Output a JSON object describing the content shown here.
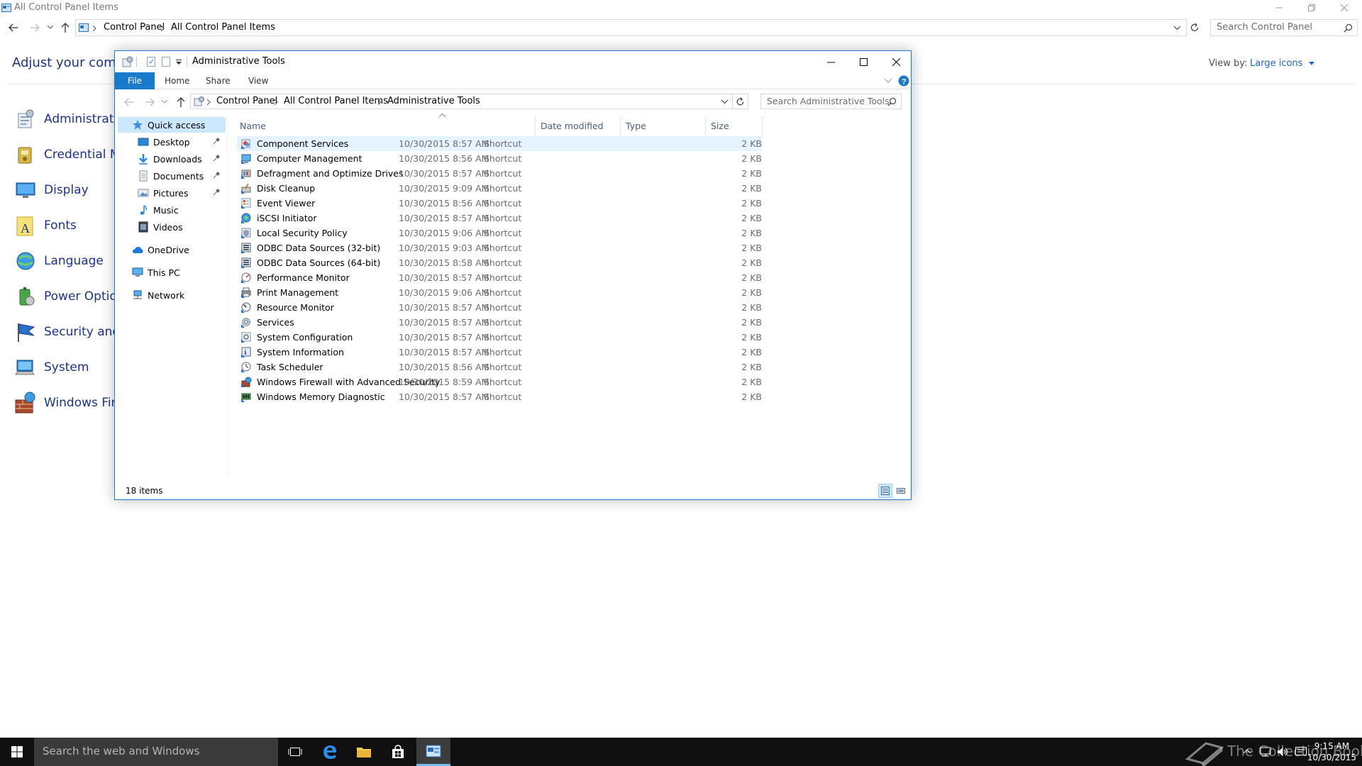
{
  "background_window": {
    "title": "All Control Panel Items",
    "breadcrumb": [
      "Control Panel",
      "All Control Panel Items"
    ],
    "search_placeholder": "Search Control Panel",
    "header": "Adjust your compute",
    "view_by_label": "View by:",
    "view_by_value": "Large icons",
    "items": [
      {
        "label": "Administrative",
        "icon": "administrative-tools-icon"
      },
      {
        "label": "Credential Ma",
        "icon": "credential-manager-icon"
      },
      {
        "label": "Display",
        "icon": "display-icon"
      },
      {
        "label": "Fonts",
        "icon": "fonts-icon"
      },
      {
        "label": "Language",
        "icon": "language-icon"
      },
      {
        "label": "Power Options",
        "icon": "power-options-icon"
      },
      {
        "label": "Security and M",
        "icon": "security-maintenance-icon"
      },
      {
        "label": "System",
        "icon": "system-icon"
      },
      {
        "label": "Windows Firew",
        "icon": "windows-firewall-icon"
      }
    ]
  },
  "explorer": {
    "title": "Administrative Tools",
    "ribbon": {
      "file": "File",
      "tabs": [
        "Home",
        "Share",
        "View"
      ]
    },
    "breadcrumb": [
      "Control Panel",
      "All Control Panel Items",
      "Administrative Tools"
    ],
    "search_placeholder": "Search Administrative Tools",
    "nav": {
      "quick_access": "Quick access",
      "pinned": [
        {
          "label": "Desktop",
          "pinned": true
        },
        {
          "label": "Downloads",
          "pinned": true
        },
        {
          "label": "Documents",
          "pinned": true
        },
        {
          "label": "Pictures",
          "pinned": true
        },
        {
          "label": "Music",
          "pinned": false
        },
        {
          "label": "Videos",
          "pinned": false
        }
      ],
      "onedrive": "OneDrive",
      "this_pc": "This PC",
      "network": "Network"
    },
    "columns": {
      "name": "Name",
      "date": "Date modified",
      "type": "Type",
      "size": "Size"
    },
    "files": [
      {
        "name": "Component Services",
        "date": "10/30/2015 8:57 AM",
        "type": "Shortcut",
        "size": "2 KB"
      },
      {
        "name": "Computer Management",
        "date": "10/30/2015 8:56 AM",
        "type": "Shortcut",
        "size": "2 KB"
      },
      {
        "name": "Defragment and Optimize Drives",
        "date": "10/30/2015 8:57 AM",
        "type": "Shortcut",
        "size": "2 KB"
      },
      {
        "name": "Disk Cleanup",
        "date": "10/30/2015 9:09 AM",
        "type": "Shortcut",
        "size": "2 KB"
      },
      {
        "name": "Event Viewer",
        "date": "10/30/2015 8:56 AM",
        "type": "Shortcut",
        "size": "2 KB"
      },
      {
        "name": "iSCSI Initiator",
        "date": "10/30/2015 8:57 AM",
        "type": "Shortcut",
        "size": "2 KB"
      },
      {
        "name": "Local Security Policy",
        "date": "10/30/2015 9:06 AM",
        "type": "Shortcut",
        "size": "2 KB"
      },
      {
        "name": "ODBC Data Sources (32-bit)",
        "date": "10/30/2015 9:03 AM",
        "type": "Shortcut",
        "size": "2 KB"
      },
      {
        "name": "ODBC Data Sources (64-bit)",
        "date": "10/30/2015 8:58 AM",
        "type": "Shortcut",
        "size": "2 KB"
      },
      {
        "name": "Performance Monitor",
        "date": "10/30/2015 8:57 AM",
        "type": "Shortcut",
        "size": "2 KB"
      },
      {
        "name": "Print Management",
        "date": "10/30/2015 9:06 AM",
        "type": "Shortcut",
        "size": "2 KB"
      },
      {
        "name": "Resource Monitor",
        "date": "10/30/2015 8:57 AM",
        "type": "Shortcut",
        "size": "2 KB"
      },
      {
        "name": "Services",
        "date": "10/30/2015 8:57 AM",
        "type": "Shortcut",
        "size": "2 KB"
      },
      {
        "name": "System Configuration",
        "date": "10/30/2015 8:57 AM",
        "type": "Shortcut",
        "size": "2 KB"
      },
      {
        "name": "System Information",
        "date": "10/30/2015 8:57 AM",
        "type": "Shortcut",
        "size": "2 KB"
      },
      {
        "name": "Task Scheduler",
        "date": "10/30/2015 8:56 AM",
        "type": "Shortcut",
        "size": "2 KB"
      },
      {
        "name": "Windows Firewall with Advanced Security",
        "date": "10/30/2015 8:59 AM",
        "type": "Shortcut",
        "size": "2 KB"
      },
      {
        "name": "Windows Memory Diagnostic",
        "date": "10/30/2015 8:57 AM",
        "type": "Shortcut",
        "size": "2 KB"
      }
    ],
    "status": "18 items"
  },
  "taskbar": {
    "search_placeholder": "Search the web and Windows",
    "time": "9:15 AM",
    "date": "10/30/2015",
    "watermark": "The Collection Book"
  },
  "colors": {
    "accent": "#1979ca",
    "link": "#1e3287",
    "selection": "#cce8ff",
    "taskbar": "#101010"
  }
}
